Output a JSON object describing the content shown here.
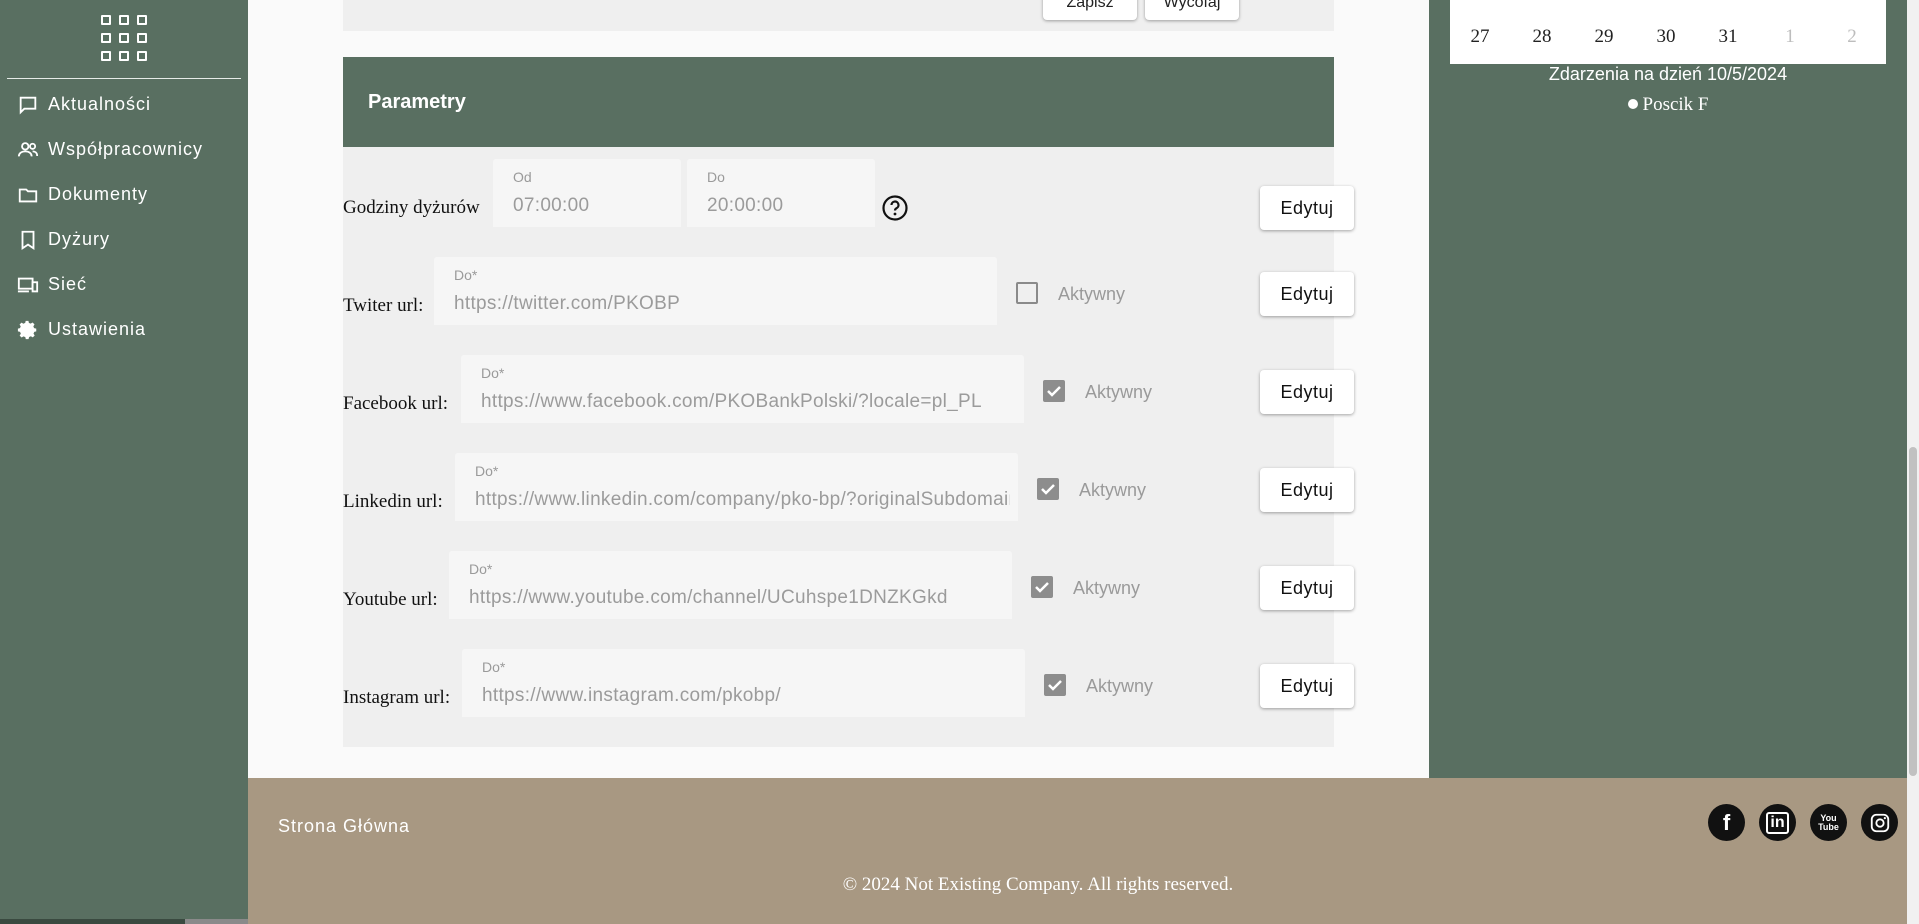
{
  "sidebar": {
    "menu_icon": "apps-grid-icon",
    "items": [
      {
        "label": "Aktualności",
        "icon": "chat-bubble-icon"
      },
      {
        "label": "Współpracownicy",
        "icon": "people-icon"
      },
      {
        "label": "Dokumenty",
        "icon": "folder-icon"
      },
      {
        "label": "Dyżury",
        "icon": "bookmark-icon"
      },
      {
        "label": "Sieć",
        "icon": "devices-icon"
      },
      {
        "label": "Ustawienia",
        "icon": "gear-icon"
      }
    ]
  },
  "top_actions": {
    "save_label": "Zapisz",
    "cancel_label": "Wycofaj"
  },
  "params": {
    "title": "Parametry",
    "edit_label": "Edytuj",
    "active_label": "Aktywny",
    "duty_hours": {
      "label": "Godziny dyżurów",
      "from_label": "Od",
      "from_value": "07:00:00",
      "to_label": "Do",
      "to_value": "20:00:00",
      "help_icon": "help-circle-icon"
    },
    "links": [
      {
        "label": "Twiter url:",
        "field_label": "Do*",
        "value": "https://twitter.com/PKOBP",
        "active": false
      },
      {
        "label": "Facebook url:",
        "field_label": "Do*",
        "value": "https://www.facebook.com/PKOBankPolski/?locale=pl_PL",
        "active": true
      },
      {
        "label": "Linkedin url:",
        "field_label": "Do*",
        "value": "https://www.linkedin.com/company/pko-bp/?originalSubdomain=pl",
        "active": true
      },
      {
        "label": "Youtube url:",
        "field_label": "Do*",
        "value": "https://www.youtube.com/channel/UCuhspe1DNZKGkd",
        "active": true
      },
      {
        "label": "Instagram url:",
        "field_label": "Do*",
        "value": "https://www.instagram.com/pkobp/",
        "active": true
      }
    ]
  },
  "calendar": {
    "days": [
      {
        "n": "27",
        "muted": false
      },
      {
        "n": "28",
        "muted": false
      },
      {
        "n": "29",
        "muted": false
      },
      {
        "n": "30",
        "muted": false
      },
      {
        "n": "31",
        "muted": false
      },
      {
        "n": "1",
        "muted": true
      },
      {
        "n": "2",
        "muted": true
      }
    ],
    "events_title": "Zdarzenia na dzień 10/5/2024",
    "events": [
      "Poscik F"
    ]
  },
  "footer": {
    "home_link": "Strona Główna",
    "socials": [
      {
        "name": "facebook-icon",
        "glyph": "f"
      },
      {
        "name": "linkedin-icon",
        "glyph": "in"
      },
      {
        "name": "youtube-icon",
        "glyph": "You Tube"
      },
      {
        "name": "instagram-icon",
        "glyph": "ig"
      }
    ],
    "copyright": "© 2024 Not Existing Company. All rights reserved."
  },
  "colors": {
    "sidebar": "#596f61",
    "footer": "#a89882",
    "panel": "#efefef"
  }
}
